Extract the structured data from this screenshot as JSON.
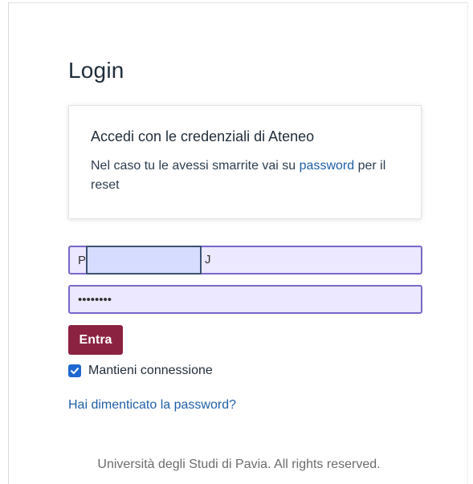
{
  "page": {
    "title": "Login"
  },
  "info_card": {
    "title": "Accedi con le credenziali di Ateneo",
    "text_before_link": "Nel caso tu le avessi smarrite vai su ",
    "link_text": "password",
    "text_after_link": " per il reset"
  },
  "form": {
    "username_value": "Pl",
    "username_tail": "J",
    "password_value": "••••••••",
    "submit_label": "Entra",
    "remember_checked": true,
    "remember_label": "Mantieni connessione",
    "forgot_label": "Hai dimenticato la password?"
  },
  "footer": {
    "text": "Università degli Studi di Pavia. All rights reserved."
  },
  "colors": {
    "submit_button": "#8b2241",
    "link": "#1f5fa8",
    "input_background": "#ebe8ff",
    "input_border": "#7a67c9",
    "checkbox": "#1e66d0"
  },
  "icons": {
    "checkbox": "checkmark-icon"
  }
}
